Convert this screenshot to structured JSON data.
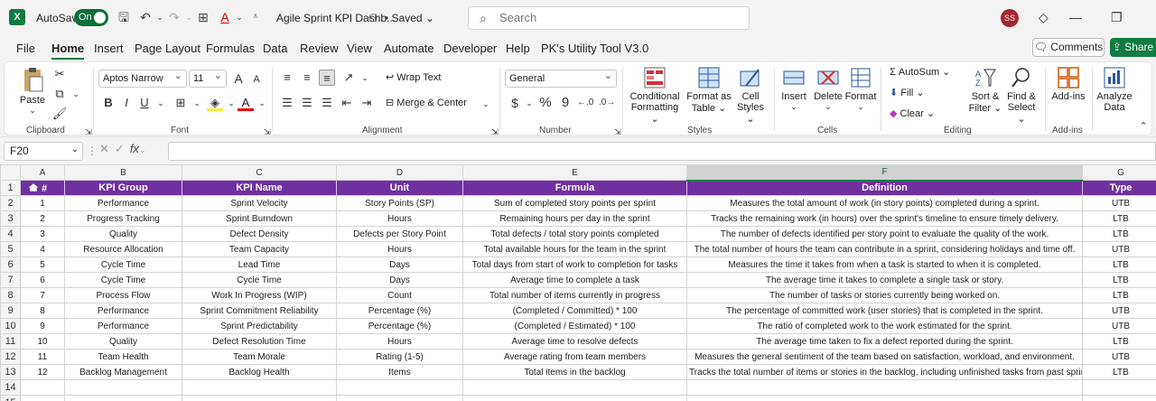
{
  "title_bar": {
    "app_logo": "X",
    "autosave_label": "AutoSave",
    "autosave_state": "On",
    "document_title": "Agile Sprint KPI Dashb...",
    "saved_status": "Saved",
    "search_placeholder": "Search",
    "user_initials": "SS"
  },
  "menu": {
    "tabs": [
      "File",
      "Home",
      "Insert",
      "Page Layout",
      "Formulas",
      "Data",
      "Review",
      "View",
      "Automate",
      "Developer",
      "Help",
      "PK's Utility Tool V3.0"
    ],
    "active_tab": "Home",
    "comments_label": "Comments",
    "share_label": "Share"
  },
  "ribbon": {
    "clipboard": {
      "paste_label": "Paste",
      "group_label": "Clipboard"
    },
    "font": {
      "font_name": "Aptos Narrow",
      "font_size": "11",
      "bold": "B",
      "italic": "I",
      "underline": "U",
      "grow": "A",
      "shrink": "A",
      "font_color": "A",
      "group_label": "Font"
    },
    "alignment": {
      "wrap_text_label": "Wrap Text",
      "merge_label": "Merge & Center",
      "group_label": "Alignment"
    },
    "number": {
      "format": "General",
      "currency": "$",
      "percent": "%",
      "comma": "9",
      "group_label": "Number"
    },
    "styles": {
      "conditional_line1": "Conditional",
      "conditional_line2": "Formatting",
      "format_table_line1": "Format as",
      "format_table_line2": "Table",
      "cell_styles_line1": "Cell",
      "cell_styles_line2": "Styles",
      "group_label": "Styles"
    },
    "cells": {
      "insert_label": "Insert",
      "delete_label": "Delete",
      "format_label": "Format",
      "group_label": "Cells"
    },
    "editing": {
      "autosum_label": "AutoSum",
      "fill_label": "Fill",
      "clear_label": "Clear",
      "sort_line1": "Sort &",
      "sort_line2": "Filter",
      "find_line1": "Find &",
      "find_line2": "Select",
      "group_label": "Editing"
    },
    "addins": {
      "addins_label": "Add-ins",
      "group_label": "Add-ins"
    },
    "analyze": {
      "line1": "Analyze",
      "line2": "Data"
    }
  },
  "formula_bar": {
    "name_box": "F20",
    "fx": "fx",
    "value": ""
  },
  "sheet": {
    "columns": [
      "A",
      "B",
      "C",
      "D",
      "E",
      "F",
      "G"
    ],
    "selected_column": "F",
    "header_row": [
      "#",
      "KPI Group",
      "KPI Name",
      "Unit",
      "Formula",
      "Definition",
      "Type"
    ],
    "rows": [
      [
        "1",
        "Performance",
        "Sprint Velocity",
        "Story Points (SP)",
        "Sum of completed story points per sprint",
        "Measures the total amount of work (in story points) completed during a sprint.",
        "UTB"
      ],
      [
        "2",
        "Progress Tracking",
        "Sprint Burndown",
        "Hours",
        "Remaining hours per day in the sprint",
        "Tracks the remaining work (in hours) over the sprint's timeline to ensure timely delivery.",
        "LTB"
      ],
      [
        "3",
        "Quality",
        "Defect Density",
        "Defects per Story Point",
        "Total defects / total story points completed",
        "The number of defects identified per story point to evaluate the quality of the work.",
        "LTB"
      ],
      [
        "4",
        "Resource Allocation",
        "Team Capacity",
        "Hours",
        "Total available hours for the team in the sprint",
        "The total number of hours the team can contribute in a sprint, considering holidays and time off.",
        "UTB"
      ],
      [
        "5",
        "Cycle Time",
        "Lead Time",
        "Days",
        "Total days from start of work to completion for tasks",
        "Measures the time it takes from when a task is started to when it is completed.",
        "LTB"
      ],
      [
        "6",
        "Cycle Time",
        "Cycle Time",
        "Days",
        "Average time to complete a task",
        "The average time it takes to complete a single task or story.",
        "LTB"
      ],
      [
        "7",
        "Process Flow",
        "Work In Progress (WIP)",
        "Count",
        "Total number of items currently in progress",
        "The number of tasks or stories currently being worked on.",
        "LTB"
      ],
      [
        "8",
        "Performance",
        "Sprint Commitment Reliability",
        "Percentage (%)",
        "(Completed / Committed) * 100",
        "The percentage of committed work (user stories) that is completed in the sprint.",
        "UTB"
      ],
      [
        "9",
        "Performance",
        "Sprint Predictability",
        "Percentage (%)",
        "(Completed / Estimated) * 100",
        "The ratio of completed work to the work estimated for the sprint.",
        "UTB"
      ],
      [
        "10",
        "Quality",
        "Defect Resolution Time",
        "Hours",
        "Average time to resolve defects",
        "The average time taken to fix a defect reported during the sprint.",
        "LTB"
      ],
      [
        "11",
        "Team Health",
        "Team Morale",
        "Rating (1-5)",
        "Average rating from team members",
        "Measures the general sentiment of the team based on satisfaction, workload, and environment.",
        "UTB"
      ],
      [
        "12",
        "Backlog Management",
        "Backlog Health",
        "Items",
        "Total items in the backlog",
        "Tracks the total number of items or stories in the backlog, including unfinished tasks from past sprints.",
        "LTB"
      ]
    ],
    "row_numbers": [
      "1",
      "2",
      "3",
      "4",
      "5",
      "6",
      "7",
      "8",
      "9",
      "10",
      "11",
      "12",
      "13",
      "14",
      "15"
    ],
    "header_color": "#7030a0",
    "accent_color": "#107c41"
  }
}
